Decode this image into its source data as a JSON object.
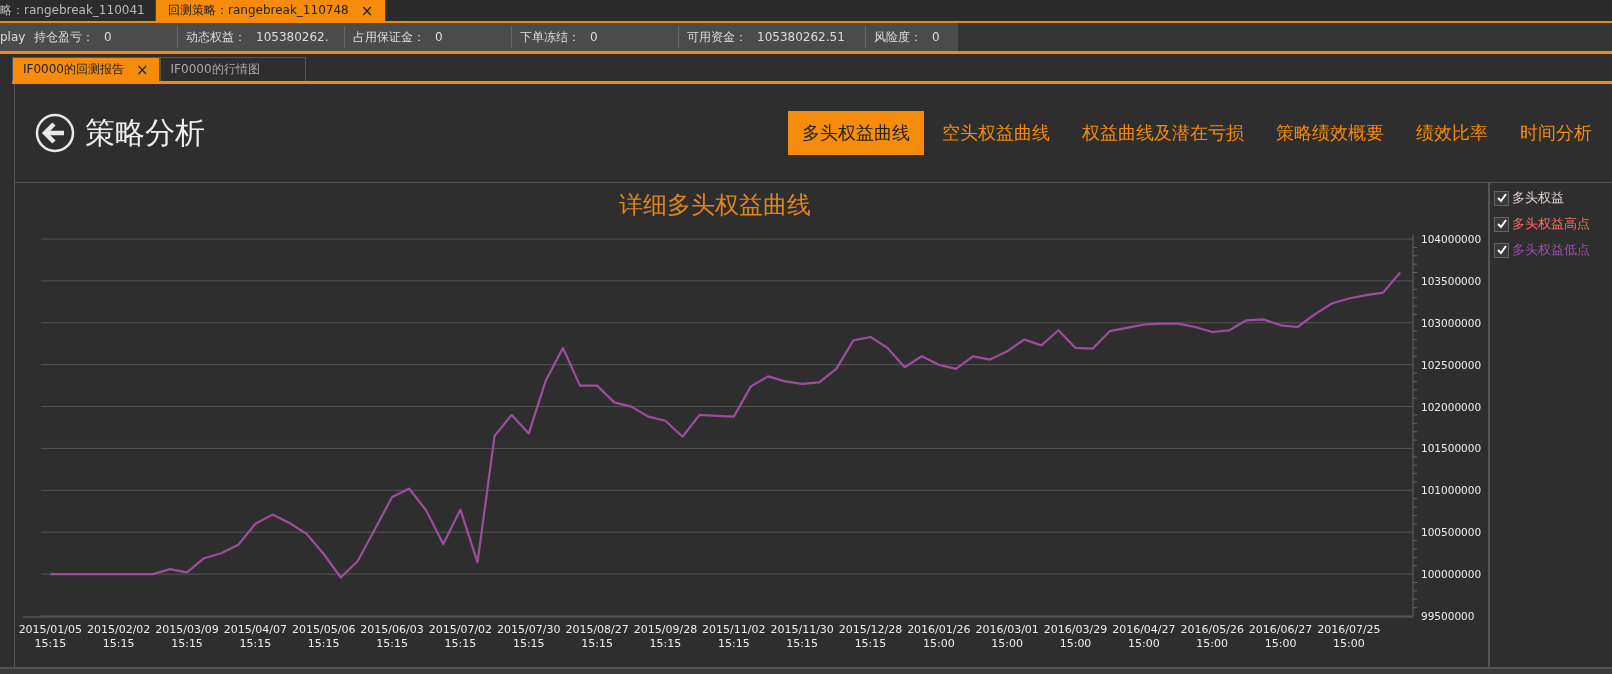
{
  "window_tabs": [
    {
      "label": "略：rangebreak_110041",
      "selected": false,
      "closable": false
    },
    {
      "label": "回测策略：rangebreak_110748",
      "selected": true,
      "closable": true
    }
  ],
  "close_glyph": "×",
  "account_bar": {
    "lead": "play",
    "fields": [
      {
        "label": "持仓盈亏：",
        "value": "0"
      },
      {
        "label": "动态权益：",
        "value": "105380262."
      },
      {
        "label": "占用保证金：",
        "value": "0"
      },
      {
        "label": "下单冻结：",
        "value": "0"
      },
      {
        "label": "可用资金：",
        "value": "105380262.51"
      },
      {
        "label": "风险度：",
        "value": "0"
      }
    ]
  },
  "doc_tabs": [
    {
      "label": "IF0000的回测报告",
      "selected": true,
      "closable": true
    },
    {
      "label": "IF0000的行情图",
      "selected": false,
      "closable": false
    }
  ],
  "header": {
    "title": "策略分析"
  },
  "nav_tabs": [
    {
      "label": "多头权益曲线",
      "selected": true
    },
    {
      "label": "空头权益曲线",
      "selected": false
    },
    {
      "label": "权益曲线及潜在亏损",
      "selected": false
    },
    {
      "label": "策略绩效概要",
      "selected": false
    },
    {
      "label": "绩效比率",
      "selected": false
    },
    {
      "label": "时间分析",
      "selected": false
    }
  ],
  "chart": {
    "chart_data": {
      "type": "line",
      "title": "详细多头权益曲线",
      "categories": [
        "2015/01/05 15:15",
        null,
        null,
        null,
        "2015/02/02 15:15",
        null,
        null,
        null,
        "2015/03/09 15:15",
        null,
        null,
        null,
        "2015/04/07 15:15",
        null,
        null,
        null,
        "2015/05/06 15:15",
        null,
        null,
        null,
        "2015/06/03 15:15",
        null,
        null,
        null,
        "2015/07/02 15:15",
        null,
        null,
        null,
        "2015/07/30 15:15",
        null,
        null,
        null,
        "2015/08/27 15:15",
        null,
        null,
        null,
        "2015/09/28 15:15",
        null,
        null,
        null,
        "2015/11/02 15:15",
        null,
        null,
        null,
        "2015/11/30 15:15",
        null,
        null,
        null,
        "2015/12/28 15:15",
        null,
        null,
        null,
        "2016/01/26 15:00",
        null,
        null,
        null,
        "2016/03/01 15:00",
        null,
        null,
        null,
        "2016/03/29 15:00",
        null,
        null,
        null,
        "2016/04/27 15:00",
        null,
        null,
        null,
        "2016/05/26 15:00",
        null,
        null,
        null,
        "2016/06/27 15:00",
        null,
        null,
        null,
        "2016/07/25 15:00",
        null,
        null,
        null
      ],
      "series": [
        {
          "color": "#9b4f9b",
          "values": [
            100000000,
            100000000,
            100000000,
            100000000,
            100000000,
            100000000,
            100000000,
            100060000,
            100020000,
            100190000,
            100250000,
            100350000,
            100600000,
            100710000,
            100610000,
            100480000,
            100240000,
            99960000,
            100160000,
            100540000,
            100920000,
            101020000,
            100760000,
            100360000,
            100770000,
            100140000,
            101650000,
            101900000,
            101680000,
            102310000,
            102700000,
            102250000,
            102250000,
            102050000,
            102000000,
            101880000,
            101830000,
            101640000,
            101900000,
            101890000,
            101880000,
            102240000,
            102360000,
            102300000,
            102270000,
            102290000,
            102450000,
            102790000,
            102830000,
            102700000,
            102470000,
            102600000,
            102500000,
            102450000,
            102600000,
            102560000,
            102660000,
            102800000,
            102730000,
            102910000,
            102700000,
            102690000,
            102900000,
            102940000,
            102980000,
            102990000,
            102990000,
            102950000,
            102890000,
            102910000,
            103030000,
            103040000,
            102970000,
            102950000,
            103100000,
            103230000,
            103290000,
            103330000,
            103360000,
            103600000
          ]
        }
      ],
      "ylim": [
        99500000,
        104000000
      ],
      "grid": true,
      "yticks": [
        99500000,
        100000000,
        100500000,
        101000000,
        101500000,
        102000000,
        102500000,
        103000000,
        103500000,
        104000000
      ]
    }
  },
  "legend": [
    {
      "label": "多头权益",
      "checked": true,
      "color": "#e0d0d0"
    },
    {
      "label": "多头权益高点",
      "checked": true,
      "color": "#ff6b6b"
    },
    {
      "label": "多头权益低点",
      "checked": true,
      "color": "#9b4fb0"
    }
  ]
}
